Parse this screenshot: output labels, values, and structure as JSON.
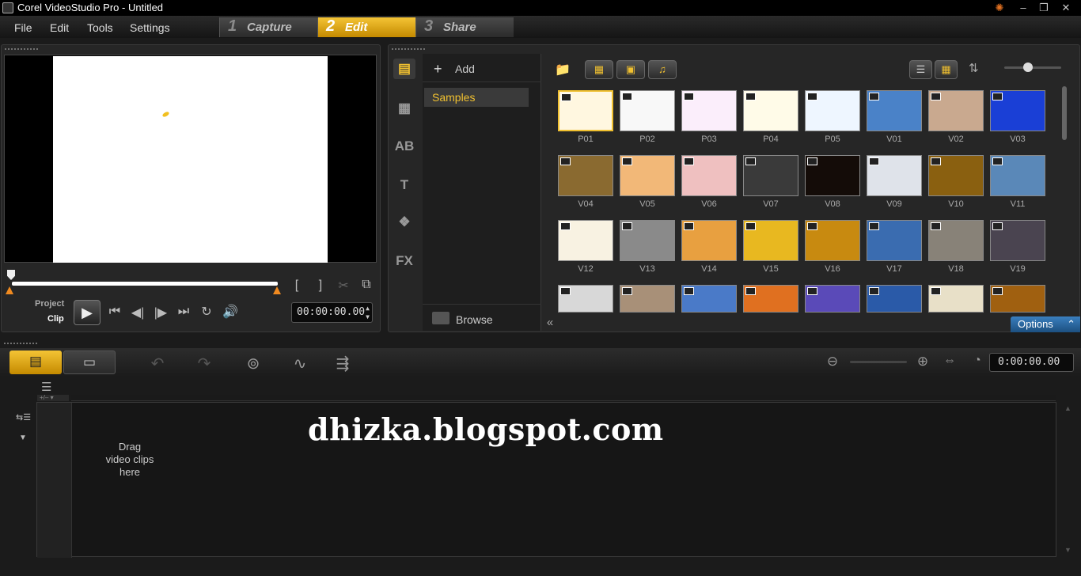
{
  "window": {
    "title": "Corel VideoStudio Pro - Untitled",
    "min": "–",
    "restore": "❐",
    "close": "✕"
  },
  "menu": [
    "File",
    "Edit",
    "Tools",
    "Settings"
  ],
  "steps": [
    {
      "num": "1",
      "label": "Capture"
    },
    {
      "num": "2",
      "label": "Edit"
    },
    {
      "num": "3",
      "label": "Share"
    }
  ],
  "player": {
    "mode_project": "Project",
    "mode_clip": "Clip",
    "timecode": "00:00:00.00",
    "position": 0
  },
  "library": {
    "add_label": "Add",
    "folders": [
      "Samples"
    ],
    "browse_label": "Browse",
    "options_label": "Options",
    "thumbs": [
      {
        "label": "P01",
        "color": "#fff7e0"
      },
      {
        "label": "P02",
        "color": "#f8f8f8"
      },
      {
        "label": "P03",
        "color": "#fbeefb"
      },
      {
        "label": "P04",
        "color": "#fffbe8"
      },
      {
        "label": "P05",
        "color": "#eef6ff"
      },
      {
        "label": "V01",
        "color": "#4a82c8"
      },
      {
        "label": "V02",
        "color": "#c9a98f"
      },
      {
        "label": "V03",
        "color": "#1a3fd6"
      },
      {
        "label": "V04",
        "color": "#8a6a30"
      },
      {
        "label": "V05",
        "color": "#f2b878"
      },
      {
        "label": "V06",
        "color": "#efc0c0"
      },
      {
        "label": "V07",
        "color": "#3a3a3a"
      },
      {
        "label": "V08",
        "color": "#140c08"
      },
      {
        "label": "V09",
        "color": "#dfe3ea"
      },
      {
        "label": "V10",
        "color": "#8a6010"
      },
      {
        "label": "V11",
        "color": "#5a88b8"
      },
      {
        "label": "V12",
        "color": "#f8f2e2"
      },
      {
        "label": "V13",
        "color": "#8a8a8a"
      },
      {
        "label": "V14",
        "color": "#e8a040"
      },
      {
        "label": "V15",
        "color": "#e8b820"
      },
      {
        "label": "V16",
        "color": "#c88a10"
      },
      {
        "label": "V17",
        "color": "#3a6cb0"
      },
      {
        "label": "V18",
        "color": "#888278"
      },
      {
        "label": "V19",
        "color": "#4a4450"
      },
      {
        "label": "",
        "color": "#d8d8d8"
      },
      {
        "label": "",
        "color": "#a89078"
      },
      {
        "label": "",
        "color": "#4a7ac8"
      },
      {
        "label": "",
        "color": "#e07020"
      },
      {
        "label": "",
        "color": "#5a4ab8"
      },
      {
        "label": "",
        "color": "#2a5aa8"
      },
      {
        "label": "",
        "color": "#e8e0c8"
      },
      {
        "label": "",
        "color": "#a06010"
      }
    ],
    "view_filters": [
      "video-filter-icon",
      "photo-filter-icon",
      "audio-filter-icon"
    ]
  },
  "timeline": {
    "timecode": "0:00:00.00",
    "drag_hint": "Drag video clips here",
    "zoom": 0
  },
  "watermark": "dhizka.blogspot.com"
}
